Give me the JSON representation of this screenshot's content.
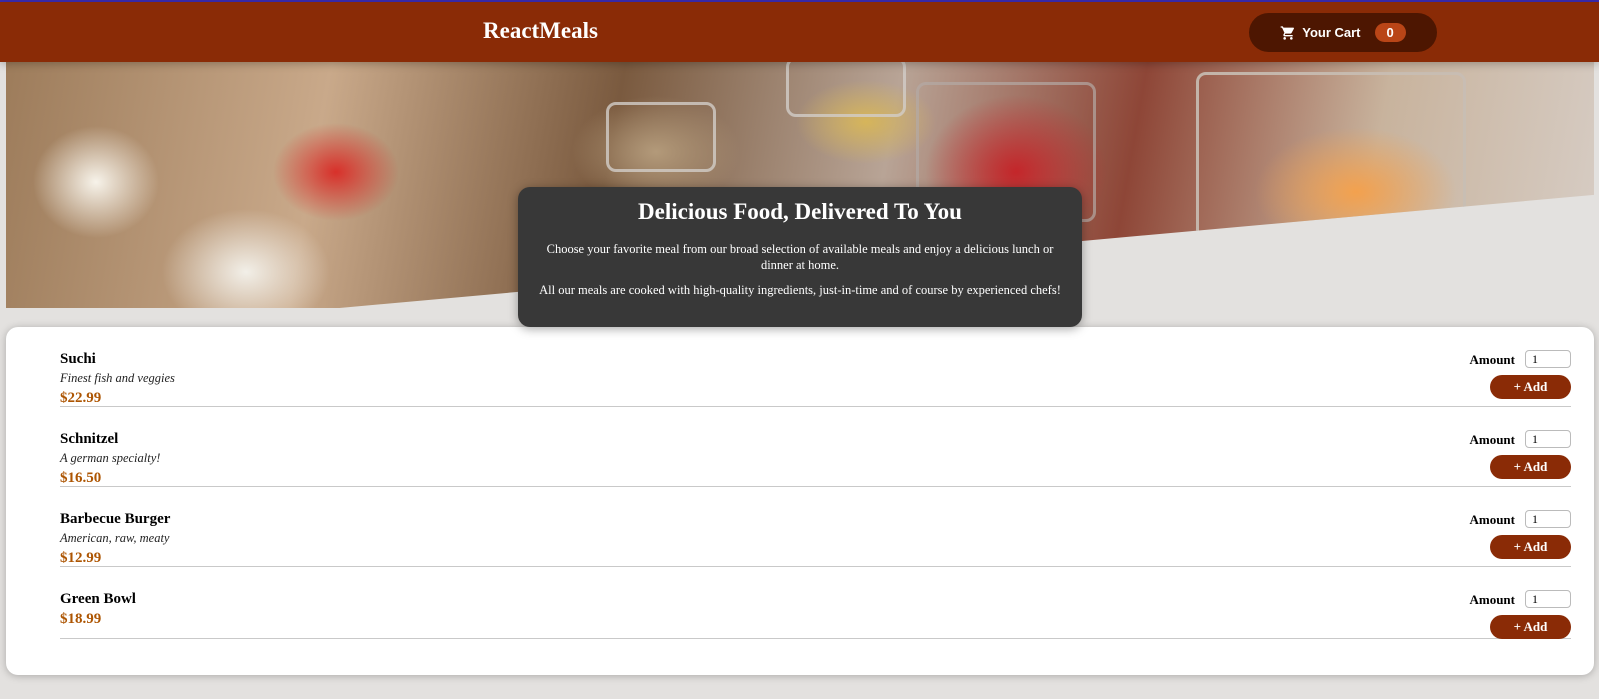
{
  "header": {
    "logo": "ReactMeals",
    "cart": {
      "label": "Your Cart",
      "count": "0",
      "icon": "cart-icon"
    }
  },
  "summary": {
    "title": "Delicious Food, Delivered To You",
    "p1": "Choose your favorite meal from our broad selection of available meals and enjoy a delicious lunch or dinner at home.",
    "p2": "All our meals are cooked with high-quality ingredients, just-in-time and of course by experienced chefs!"
  },
  "meals": [
    {
      "name": "Suchi",
      "description": "Finest fish and veggies",
      "price": "$22.99",
      "amount_label": "Amount",
      "amount_value": "1",
      "add_label": "+ Add"
    },
    {
      "name": "Schnitzel",
      "description": "A german specialty!",
      "price": "$16.50",
      "amount_label": "Amount",
      "amount_value": "1",
      "add_label": "+ Add"
    },
    {
      "name": "Barbecue Burger",
      "description": "American, raw, meaty",
      "price": "$12.99",
      "amount_label": "Amount",
      "amount_value": "1",
      "add_label": "+ Add"
    },
    {
      "name": "Green Bowl",
      "description": "",
      "price": "$18.99",
      "amount_label": "Amount",
      "amount_value": "1",
      "add_label": "+ Add"
    }
  ],
  "colors": {
    "header": "#8a2b06",
    "cart_button": "#4d1601",
    "badge": "#b94517",
    "price": "#ad5502",
    "summary_bg": "#383838"
  }
}
